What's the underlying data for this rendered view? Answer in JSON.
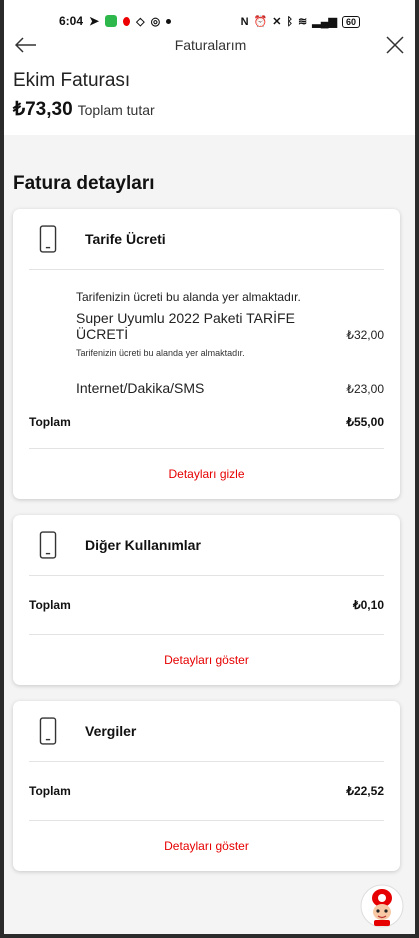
{
  "status_bar": {
    "time": "6:04",
    "battery": "60"
  },
  "header": {
    "title": "Faturalarım"
  },
  "bill": {
    "name": "Ekim Faturası",
    "amount": "₺73,30",
    "total_label": "Toplam tutar"
  },
  "section_title": "Fatura detayları",
  "cards": [
    {
      "title": "Tarife Ücreti",
      "intro": "Tarifenizin ücreti bu alanda yer almaktadır.",
      "items": [
        {
          "name": "Super Uyumlu 2022 Paketi TARİFE ÜCRETİ",
          "value": "₺32,00",
          "note": "Tarifenizin ücreti bu alanda yer almaktadır."
        },
        {
          "name": "Internet/Dakika/SMS",
          "value": "₺23,00"
        }
      ],
      "total_label": "Toplam",
      "total_value": "₺55,00",
      "link": "Detayları gizle"
    },
    {
      "title": "Diğer Kullanımlar",
      "total_label": "Toplam",
      "total_value": "₺0,10",
      "link": "Detayları göster"
    },
    {
      "title": "Vergiler",
      "total_label": "Toplam",
      "total_value": "₺22,52",
      "link": "Detayları göster"
    }
  ],
  "colors": {
    "accent": "#e60000",
    "page_bg": "#f4f4f4"
  },
  "icons": [
    "back-arrow-icon",
    "close-icon",
    "phone-icon",
    "mascot-icon"
  ]
}
